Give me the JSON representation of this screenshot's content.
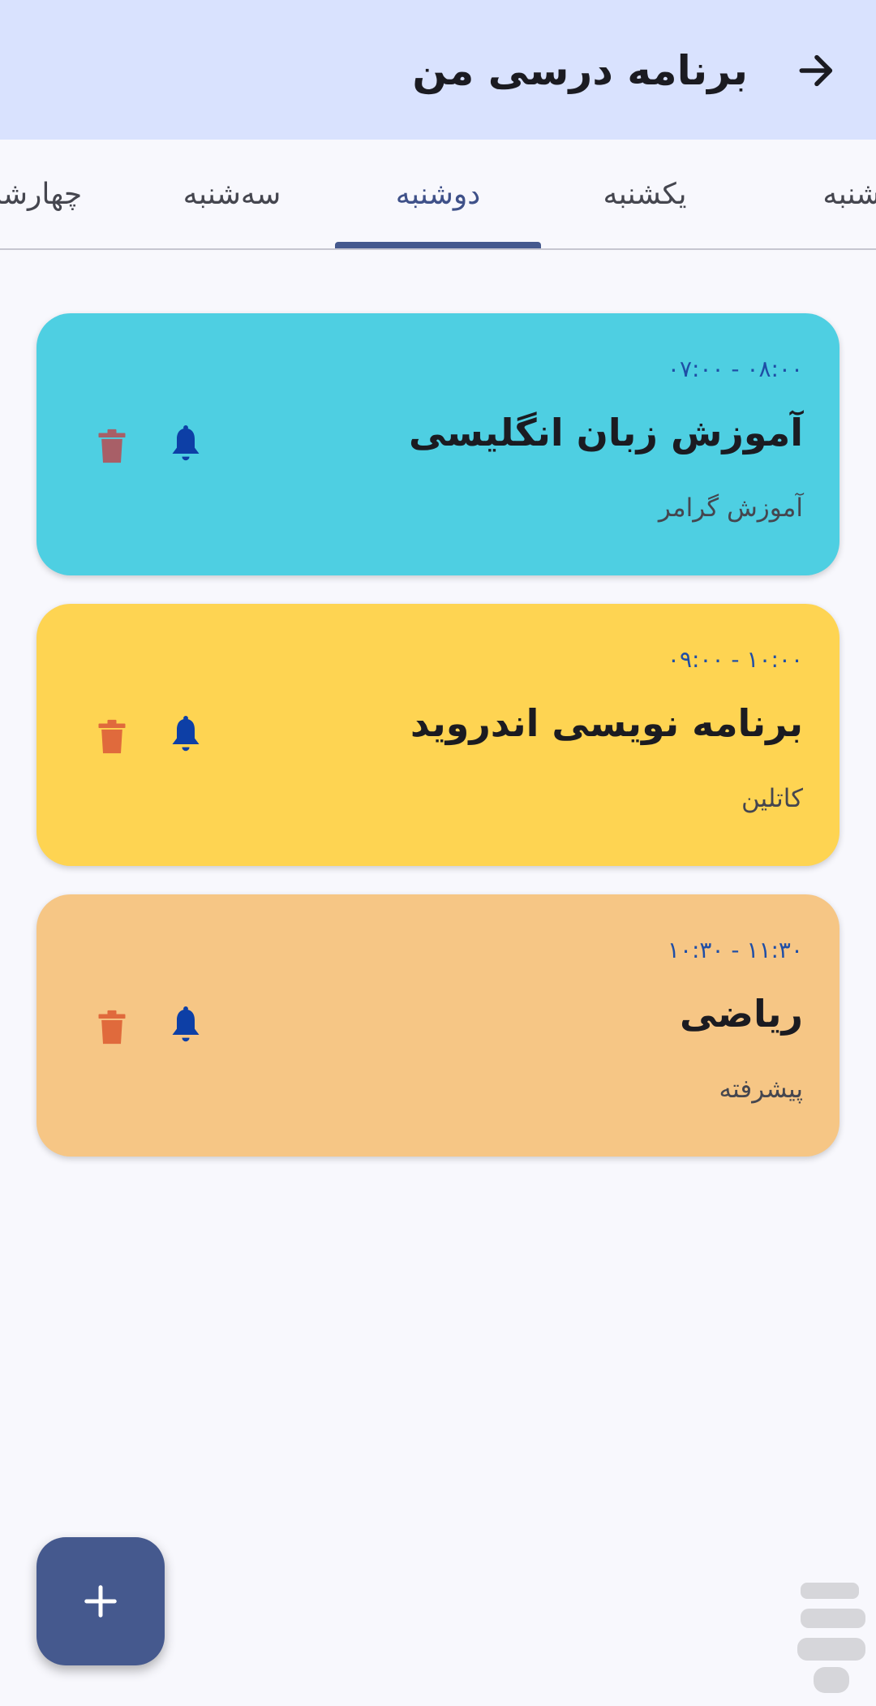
{
  "header": {
    "title": "برنامه درسی من",
    "back_icon": "arrow-right-icon"
  },
  "tabs": [
    {
      "label": "شنبه"
    },
    {
      "label": "یکشنبه"
    },
    {
      "label": "دوشنبه",
      "active": true
    },
    {
      "label": "سه‌شنبه"
    },
    {
      "label": "چهارشنبه"
    }
  ],
  "cards": [
    {
      "time": "۰۷:۰۰ - ۰۸:۰۰",
      "title": "آموزش زبان انگلیسی",
      "subtitle": "آموزش گرامر",
      "bg_color": "#4ecfe2",
      "trash_color": "#a85f67"
    },
    {
      "time": "۰۹:۰۰ - ۱۰:۰۰",
      "title": "برنامه نویسی اندروید",
      "subtitle": "کاتلین",
      "bg_color": "#fed452",
      "trash_color": "#e06a3c"
    },
    {
      "time": "۱۰:۳۰ - ۱۱:۳۰",
      "title": "ریاضی",
      "subtitle": "پیشرفته",
      "bg_color": "#f6c685",
      "trash_color": "#e06a3c"
    }
  ],
  "colors": {
    "appbar": "#d9e2fe",
    "background": "#f8f8fd",
    "accent": "#45598e",
    "bell": "#0d3fa6"
  },
  "fab": {
    "icon": "plus-icon"
  }
}
